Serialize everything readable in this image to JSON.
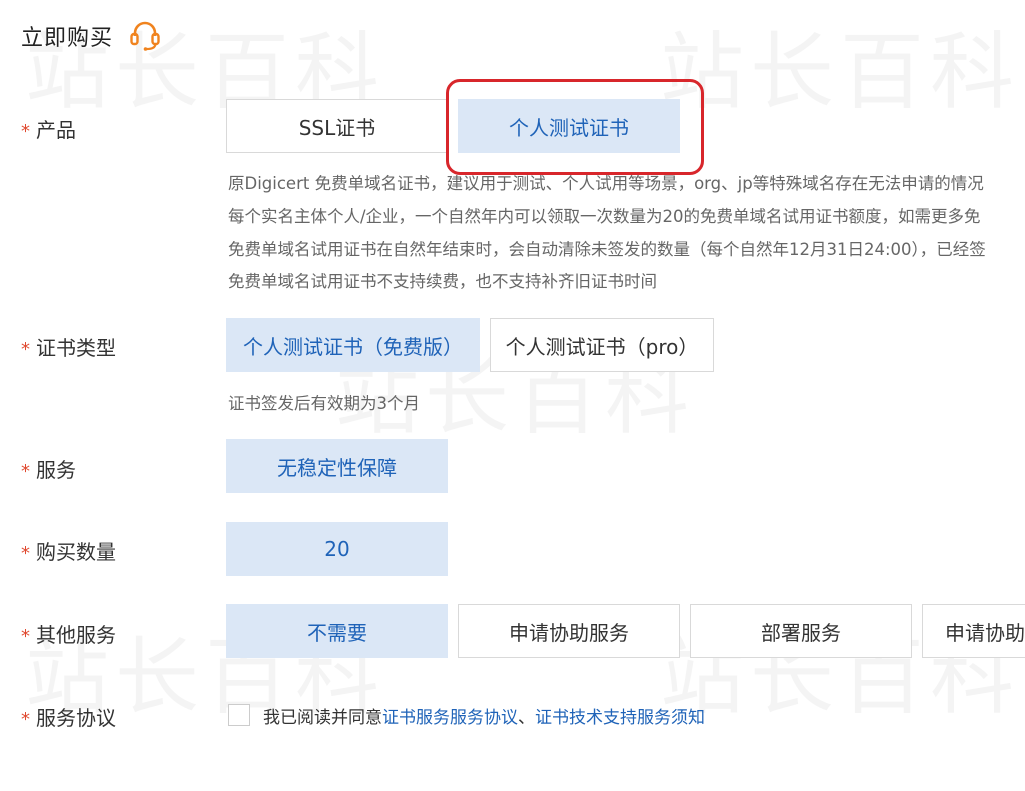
{
  "header": {
    "title": "立即购买",
    "icon": "headset-icon",
    "accent": "#f0831e"
  },
  "watermark": "站长百科",
  "product": {
    "label": "产品",
    "options": [
      "SSL证书",
      "个人测试证书"
    ],
    "selected": "个人测试证书",
    "description": [
      "原Digicert 免费单域名证书，建议用于测试、个人试用等场景，org、jp等特殊域名存在无法申请的情况",
      "每个实名主体个人/企业，一个自然年内可以领取一次数量为20的免费单域名试用证书额度，如需更多免",
      "免费单域名试用证书在自然年结束时，会自动清除未签发的数量（每个自然年12月31日24:00），已经签",
      "免费单域名试用证书不支持续费，也不支持补齐旧证书时间"
    ]
  },
  "cert_type": {
    "label": "证书类型",
    "options": [
      "个人测试证书（免费版）",
      "个人测试证书（pro）"
    ],
    "selected": "个人测试证书（免费版）",
    "note": "证书签发后有效期为3个月"
  },
  "service": {
    "label": "服务",
    "options": [
      "无稳定性保障"
    ],
    "selected": "无稳定性保障"
  },
  "quantity": {
    "label": "购买数量",
    "options": [
      "20"
    ],
    "selected": "20"
  },
  "other_service": {
    "label": "其他服务",
    "options": [
      "不需要",
      "申请协助服务",
      "部署服务",
      "申请协助"
    ],
    "selected": "不需要"
  },
  "agreement": {
    "label": "服务协议",
    "checked": false,
    "prefix": "我已阅读并同意",
    "link1": "证书服务服务协议",
    "separator": "、",
    "link2": "证书技术支持服务须知"
  },
  "colors": {
    "required_star": "#e0492f",
    "selected_bg": "#dbe7f6",
    "selected_text": "#1f63b8",
    "highlight_border": "#d8262b",
    "link": "#1f63b8"
  }
}
